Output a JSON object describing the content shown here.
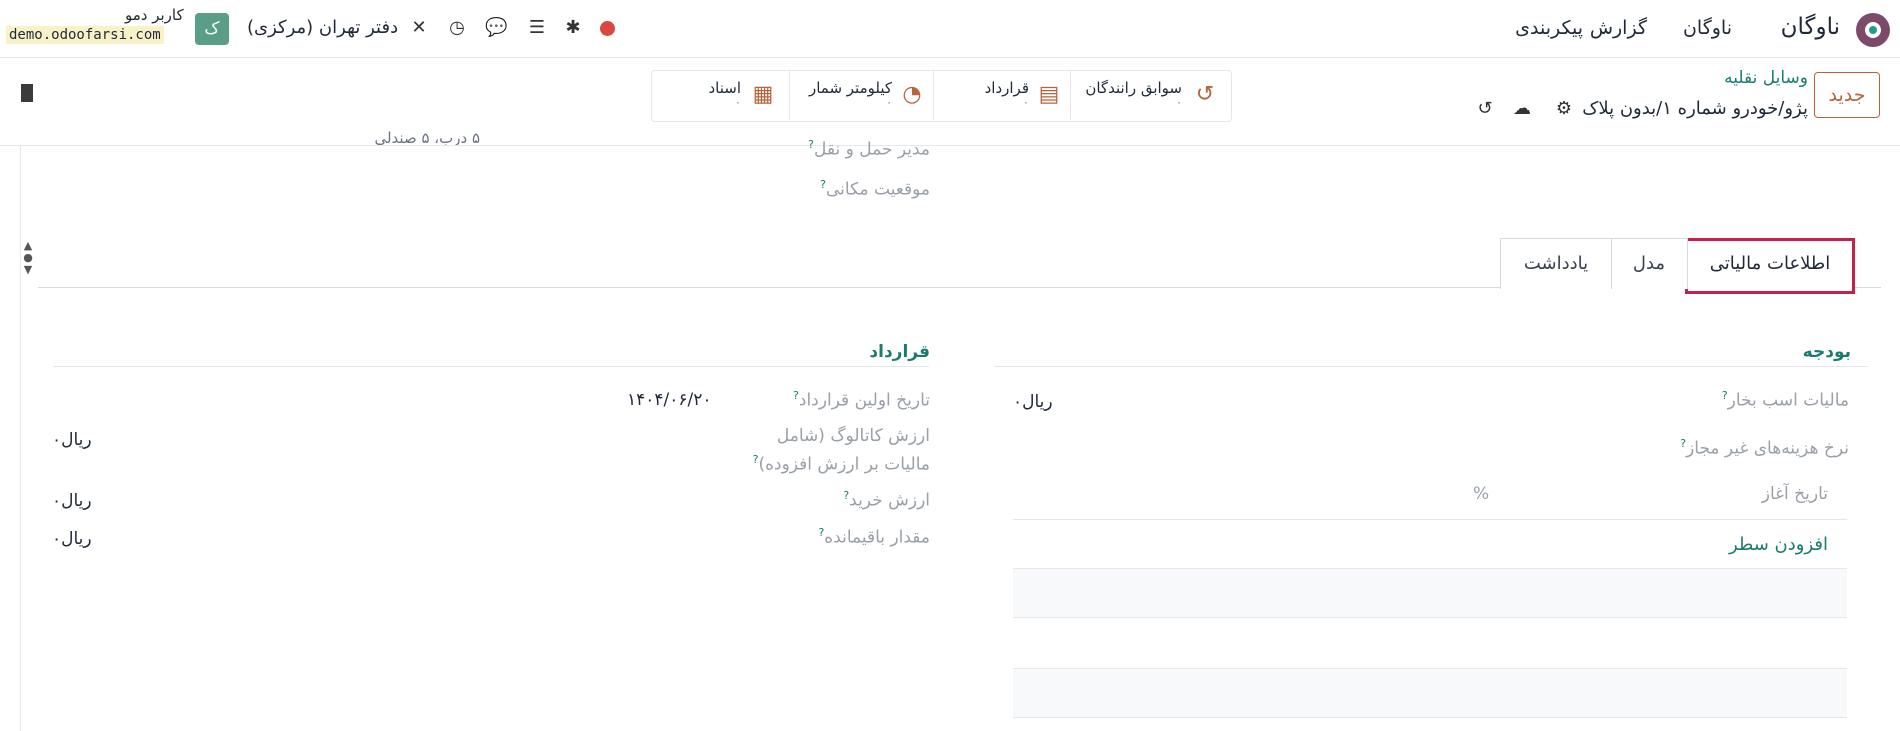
{
  "navbar": {
    "app_title": "ناوگان",
    "menus": [
      "ناوگان",
      "گزارش",
      "پیکربندی"
    ],
    "company": "دفتر تهران (مرکزی)",
    "avatar_letter": "ک",
    "user_name": "کاربر دمو",
    "db_name": "demo.odoofarsi.com"
  },
  "control": {
    "new_button": "جدید",
    "breadcrumb": "وسایل نقلیه",
    "record_title": "پژو/خودرو شماره ۱/بدون پلاک",
    "smart_buttons": [
      {
        "label": "سوابق رانندگان",
        "count": "۰",
        "icon": "history-icon"
      },
      {
        "label": "قرارداد",
        "count": "۰",
        "icon": "book-icon"
      },
      {
        "label": "کیلومتر شمار",
        "count": "۰",
        "icon": "speedometer-icon"
      },
      {
        "label": "اسناد",
        "count": "۰",
        "icon": "document-icon"
      }
    ]
  },
  "top_fields": {
    "fleet_manager_label": "مدیر حمل و نقل",
    "location_label": "موقعیت مکانی",
    "cut_text": "۵ درب، ۵ صندلی"
  },
  "tabs": [
    {
      "label": "اطلاعات مالیاتی",
      "active": true
    },
    {
      "label": "مدل",
      "active": false
    },
    {
      "label": "یادداشت",
      "active": false
    }
  ],
  "budget": {
    "title": "بودجه",
    "horsepower_tax_label": "مالیات اسب بخار",
    "horsepower_tax_value": "۰ریال",
    "disallowed_expense_label": "نرخ هزینه‌های غیر مجاز",
    "col_start_date": "تاریخ آغاز",
    "col_percent": "%",
    "add_line": "افزودن سطر"
  },
  "contract": {
    "title": "قرارداد",
    "first_contract_label": "تاریخ اولین قرارداد",
    "first_contract_value": "۱۴۰۴/۰۶/۲۰",
    "catalog_label_1": "ارزش کاتالوگ (شامل",
    "catalog_label_2": "مالیات بر ارزش افزوده)",
    "catalog_value": "۰ریال",
    "purchase_label": "ارزش خرید",
    "purchase_value": "۰ریال",
    "residual_label": "مقدار باقیمانده",
    "residual_value": "۰ریال"
  },
  "colors": {
    "accent": "#1b7c6e",
    "brand": "#b4643c",
    "highlight": "#c5224a"
  }
}
